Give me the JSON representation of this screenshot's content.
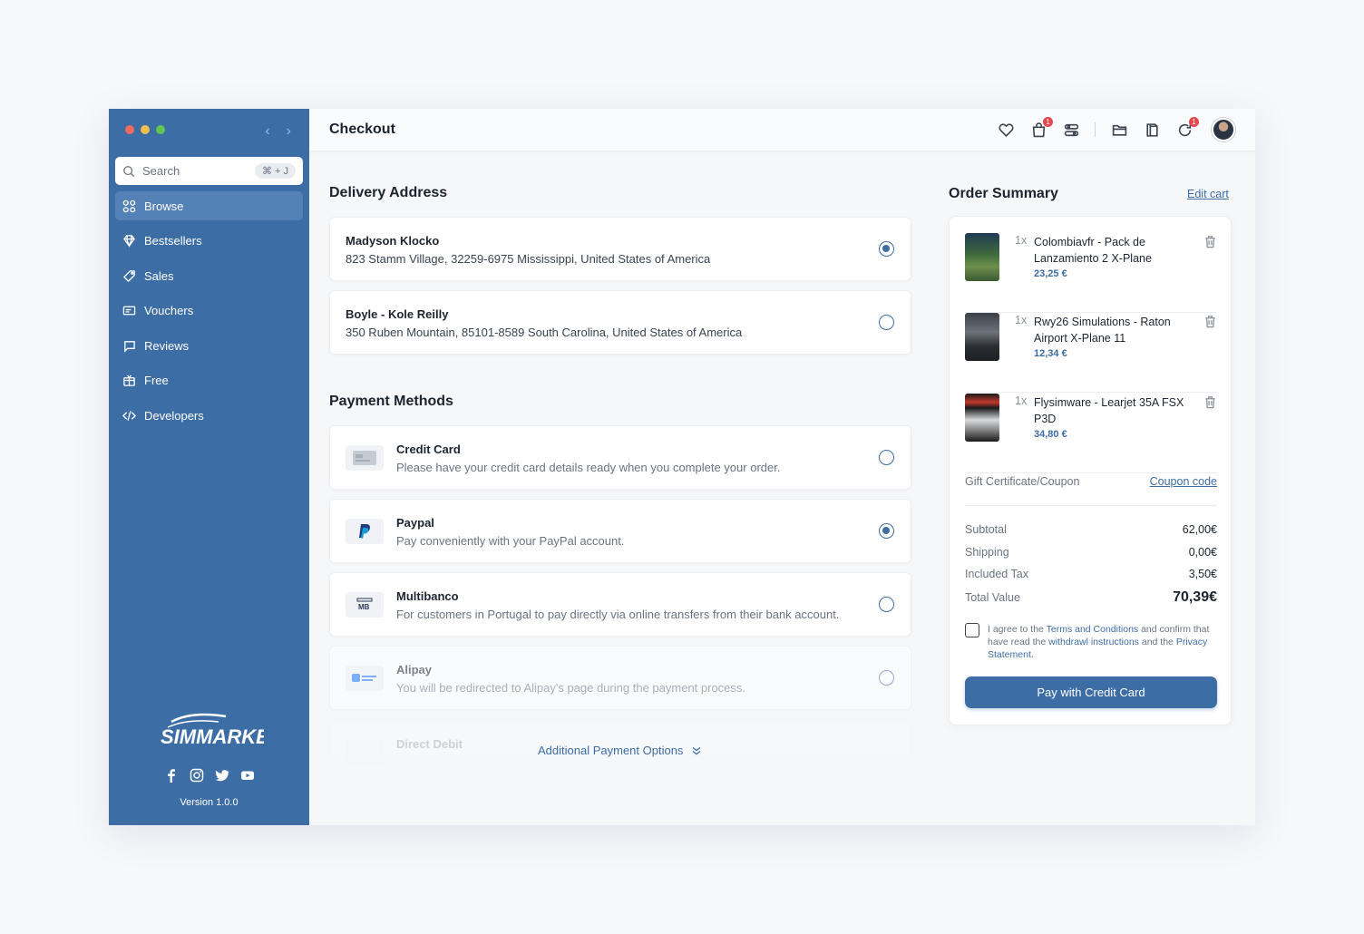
{
  "sidebar": {
    "search": {
      "placeholder": "Search",
      "shortcut": "⌘ + J"
    },
    "items": [
      {
        "label": "Browse",
        "icon": "grid-icon",
        "active": true
      },
      {
        "label": "Bestsellers",
        "icon": "diamond-icon"
      },
      {
        "label": "Sales",
        "icon": "tag-icon"
      },
      {
        "label": "Vouchers",
        "icon": "voucher-icon"
      },
      {
        "label": "Reviews",
        "icon": "chat-icon"
      },
      {
        "label": "Free",
        "icon": "gift-icon"
      },
      {
        "label": "Developers",
        "icon": "code-icon"
      }
    ],
    "logo": "SIMMARKET",
    "version": "Version 1.0.0"
  },
  "header": {
    "title": "Checkout",
    "badges": {
      "cart": "1",
      "notifications": "1"
    }
  },
  "delivery": {
    "title": "Delivery Address",
    "addresses": [
      {
        "name": "Madyson Klocko",
        "line": "823 Stamm Village, 32259-6975 Mississippi, United States of America",
        "selected": true
      },
      {
        "name": "Boyle - Kole Reilly",
        "line": "350 Ruben Mountain, 85101-8589 South Carolina, United States of America",
        "selected": false
      }
    ]
  },
  "payment": {
    "title": "Payment Methods",
    "methods": [
      {
        "title": "Credit Card",
        "desc": "Please have your credit card details ready when you complete your order.",
        "selected": false,
        "icon": "credit-card-icon"
      },
      {
        "title": "Paypal",
        "desc": "Pay conveniently with your PayPal account.",
        "selected": true,
        "icon": "paypal-icon"
      },
      {
        "title": "Multibanco",
        "desc": "For customers in Portugal to pay directly via online transfers from their bank account.",
        "selected": false,
        "icon": "multibanco-icon"
      },
      {
        "title": "Alipay",
        "desc": "You will be redirected to Alipay's page during the payment process.",
        "selected": false,
        "icon": "alipay-icon"
      },
      {
        "title": "Direct Debit",
        "desc": "",
        "selected": false,
        "icon": "bank-icon"
      }
    ],
    "more_label": "Additional Payment Options"
  },
  "summary": {
    "title": "Order Summary",
    "edit_cart": "Edit cart",
    "items": [
      {
        "qty": "1x",
        "name": "Colombiavfr - Pack de Lanzamiento 2 X-Plane",
        "price": "23,25 €"
      },
      {
        "qty": "1x",
        "name": "Rwy26 Simulations - Raton Airport X-Plane 11",
        "price": "12,34 €"
      },
      {
        "qty": "1x",
        "name": "Flysimware - Learjet 35A FSX P3D",
        "price": "34,80 €"
      }
    ],
    "coupon_label": "Gift Certificate/Coupon",
    "coupon_link": "Coupon code",
    "subtotal_label": "Subtotal",
    "subtotal": "62,00€",
    "shipping_label": "Shipping",
    "shipping": "0,00€",
    "tax_label": "Included Tax",
    "tax": "3,50€",
    "total_label": "Total Value",
    "total": "70,39€",
    "agree": {
      "pre": "I agree to the ",
      "terms": "Terms and Conditions",
      "mid": " and confirm that have read the ",
      "withdrawal": "withdrawl instructions",
      "and": " and the ",
      "privacy": "Privacy Statement",
      "end": "."
    },
    "pay_button": "Pay with Credit Card"
  }
}
